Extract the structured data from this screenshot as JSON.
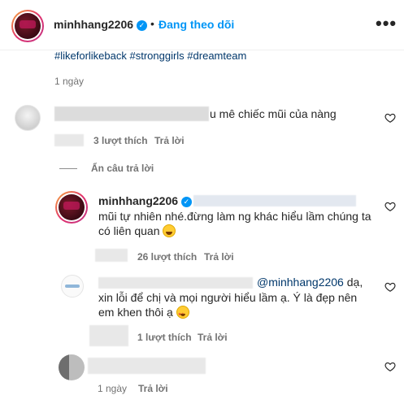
{
  "header": {
    "username": "minhhang2206",
    "separator": "•",
    "follow_state": "Đang theo dõi",
    "more": "•••"
  },
  "post": {
    "hashtags": "#likeforlikeback #stronggirls #dreamteam",
    "time": "1 ngày"
  },
  "comments": [
    {
      "text": "u mê chiếc mũi của nàng",
      "likes": "3 lượt thích",
      "reply_label": "Trả lời"
    }
  ],
  "hide_replies": "Ẩn câu trả lời",
  "replies": [
    {
      "username": "minhhang2206",
      "line1": "mũi tự nhiên nhé.đừng làm ng khác hiểu lầm chúng ta",
      "line2": "có liên quan",
      "likes": "26 lượt thích",
      "reply_label": "Trả lời"
    },
    {
      "mention": "@minhhang2206",
      "line1_tail": "dạ,",
      "line2": "xin lỗi để chị và mọi người hiểu lầm ạ. Ý là đẹp nên",
      "line3": "em khen thôi ạ",
      "likes": "1 lượt thích",
      "reply_label": "Trả lời"
    }
  ],
  "last_comment": {
    "time": "1 ngày",
    "reply_label": "Trả lời"
  },
  "colors": {
    "accent": "#0095f6",
    "link": "#00376b",
    "muted": "#737373"
  }
}
